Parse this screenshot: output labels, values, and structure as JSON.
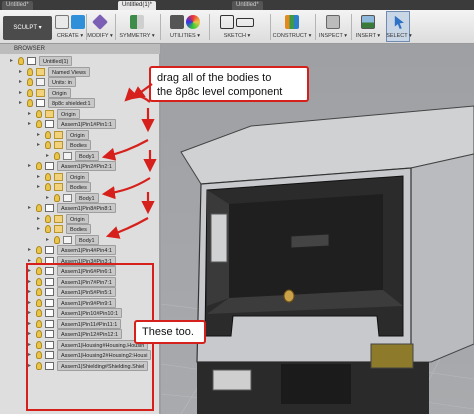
{
  "doc_tabs": [
    "Untitled*",
    "Untitled(1)*",
    "Untitled*"
  ],
  "toolbar": {
    "workspace": "SCULPT ▾",
    "groups": [
      {
        "label": "CREATE ▾",
        "icons": [
          "box-icon",
          "blue-shape-icon"
        ]
      },
      {
        "label": "MODIFY ▾",
        "icons": [
          "modify-icon"
        ]
      },
      {
        "label": "SYMMETRY ▾",
        "icons": [
          "symmetry-icon"
        ]
      },
      {
        "label": "UTILITIES ▾",
        "icons": [
          "display-icon",
          "color-icon"
        ]
      },
      {
        "label": "SKETCH ▾",
        "icons": [
          "sketch-icon",
          "rect-icon"
        ]
      },
      {
        "label": "CONSTRUCT ▾",
        "icons": [
          "plane-icon"
        ]
      },
      {
        "label": "INSPECT ▾",
        "icons": [
          "ruler-icon"
        ]
      },
      {
        "label": "INSERT ▾",
        "icons": [
          "image-icon"
        ]
      },
      {
        "label": "SELECT ▾",
        "icons": [
          "cursor-icon"
        ]
      }
    ]
  },
  "browser": {
    "header": "BROWSER",
    "rows": [
      {
        "text": "Untitled(1)",
        "indent": 0,
        "icon": "comp"
      },
      {
        "text": "Named Views",
        "indent": 1,
        "icon": "folder"
      },
      {
        "text": "Units: in",
        "indent": 1,
        "icon": "file"
      },
      {
        "text": "Origin",
        "indent": 1,
        "icon": "folder"
      },
      {
        "text": "8p8c shielded:1",
        "indent": 1,
        "icon": "comp"
      },
      {
        "text": "Origin",
        "indent": 2,
        "icon": "folder"
      },
      {
        "text": "Assem1|Pin1#Pin1:1",
        "indent": 2,
        "icon": "comp"
      },
      {
        "text": "Origin",
        "indent": 3,
        "icon": "folder"
      },
      {
        "text": "Bodies",
        "indent": 3,
        "icon": "folder"
      },
      {
        "text": "Body1",
        "indent": 4,
        "icon": "file"
      },
      {
        "text": "Assem1|Pin2#Pin2:1",
        "indent": 2,
        "icon": "comp"
      },
      {
        "text": "Origin",
        "indent": 3,
        "icon": "folder"
      },
      {
        "text": "Bodies",
        "indent": 3,
        "icon": "folder"
      },
      {
        "text": "Body1",
        "indent": 4,
        "icon": "file"
      },
      {
        "text": "Assem1|Pin8#Pin8:1",
        "indent": 2,
        "icon": "comp"
      },
      {
        "text": "Origin",
        "indent": 3,
        "icon": "folder"
      },
      {
        "text": "Bodies",
        "indent": 3,
        "icon": "folder"
      },
      {
        "text": "Body1",
        "indent": 4,
        "icon": "file"
      },
      {
        "text": "Assem1|Pin4#Pin4:1",
        "indent": 2,
        "icon": "comp"
      },
      {
        "text": "Assem1|Pin3#Pin3:1",
        "indent": 2,
        "icon": "comp"
      },
      {
        "text": "Assem1|Pin6#Pin6:1",
        "indent": 2,
        "icon": "comp"
      },
      {
        "text": "Assem1|Pin7#Pin7:1",
        "indent": 2,
        "icon": "comp"
      },
      {
        "text": "Assem1|Pin5#Pin5:1",
        "indent": 2,
        "icon": "comp"
      },
      {
        "text": "Assem1|Pin9#Pin9:1",
        "indent": 2,
        "icon": "comp"
      },
      {
        "text": "Assem1|Pin10#Pin10:1",
        "indent": 2,
        "icon": "comp"
      },
      {
        "text": "Assem1|Pin11#Pin11:1",
        "indent": 2,
        "icon": "comp"
      },
      {
        "text": "Assem1|Pin12#Pin12:1",
        "indent": 2,
        "icon": "comp"
      },
      {
        "text": "Assem1|Housing#Housing.Housin",
        "indent": 2,
        "icon": "comp"
      },
      {
        "text": "Assem1|Housing2#Housing2:Housi",
        "indent": 2,
        "icon": "comp"
      },
      {
        "text": "Assem1|Shielding#Shielding.Shiel",
        "indent": 2,
        "icon": "comp"
      }
    ]
  },
  "annotations": {
    "top": "drag all of the bodies to\nthe 8p8c level component",
    "bottom": "These too."
  },
  "colors": {
    "annotation_red": "#d6201b"
  }
}
